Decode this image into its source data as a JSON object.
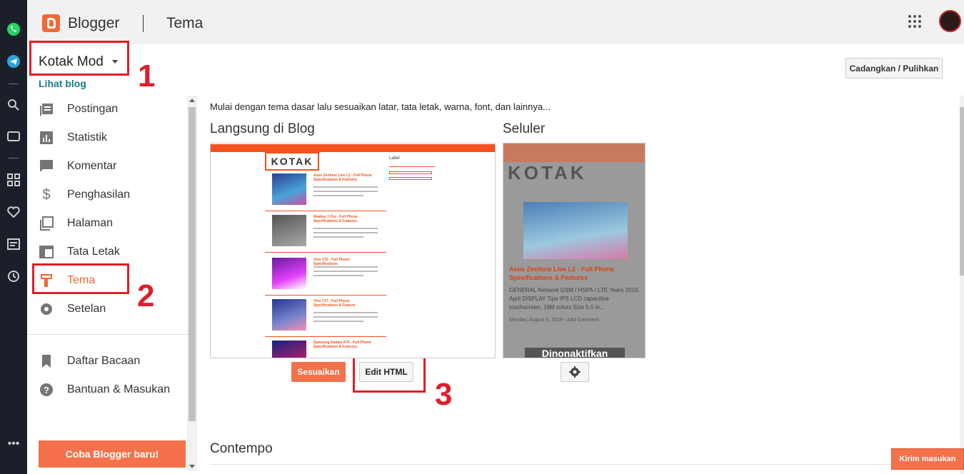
{
  "topbar": {
    "brand": "Blogger",
    "page_title": "Tema"
  },
  "blog": {
    "name": "Kotak Mod",
    "view_link": "Lihat blog"
  },
  "sidebar": {
    "items": [
      {
        "label": "Postingan",
        "icon": "posts-icon"
      },
      {
        "label": "Statistik",
        "icon": "stats-icon"
      },
      {
        "label": "Komentar",
        "icon": "comment-icon"
      },
      {
        "label": "Penghasilan",
        "icon": "dollar-icon"
      },
      {
        "label": "Halaman",
        "icon": "pages-icon"
      },
      {
        "label": "Tata Letak",
        "icon": "layout-icon"
      },
      {
        "label": "Tema",
        "icon": "theme-icon",
        "active": true
      },
      {
        "label": "Setelan",
        "icon": "gear-icon"
      }
    ],
    "secondary": [
      {
        "label": "Daftar Bacaan",
        "icon": "bookmark-icon"
      },
      {
        "label": "Bantuan & Masukan",
        "icon": "help-icon"
      }
    ],
    "try_button": "Coba Blogger baru!"
  },
  "annotations": {
    "n1": "1",
    "n2": "2",
    "n3": "3"
  },
  "main": {
    "backup_button": "Cadangkan / Pulihkan",
    "intro": "Mulai dengan tema dasar lalu sesuaikan latar, tata letak, warna, font, dan lainnya...",
    "live_label": "Langsung di Blog",
    "mobile_label": "Seluler",
    "customize_button": "Sesuaikan",
    "edit_html_button": "Edit HTML",
    "next_section": "Contempo"
  },
  "preview": {
    "logo": "KOTAK",
    "posts": [
      "Asus Zenfone Live L2 - Full Phone Specifications & Features",
      "Realme 3 Pro - Full Phone Specifications & Features",
      "Vivo V15 - Full Phone Specifications",
      "Vivo Y17 - Full Phone Specifications & Feature",
      "Samsung Galaxy A70 - Full Phone Specifications & Features"
    ],
    "sidebar_label": "Label"
  },
  "mobile_preview": {
    "logo": "KOTAK",
    "title": "Asus Zenfone Live L2 - Full Phone Spesifications & Features",
    "text": "GENERAL Network GSM / HSPA / LTE Years 2019, April DISPLAY Tipe IPS LCD capacitive touchscreen, 16M colors Size 5.5 in...",
    "meta": "Monday, August 5, 2019 - Add Comment",
    "disabled": "Dinonaktifkan"
  },
  "feedback_button": "Kirim masukan",
  "colors": {
    "accent": "#f06a35",
    "annotation": "#e11d2a",
    "link": "#1a7a91"
  }
}
